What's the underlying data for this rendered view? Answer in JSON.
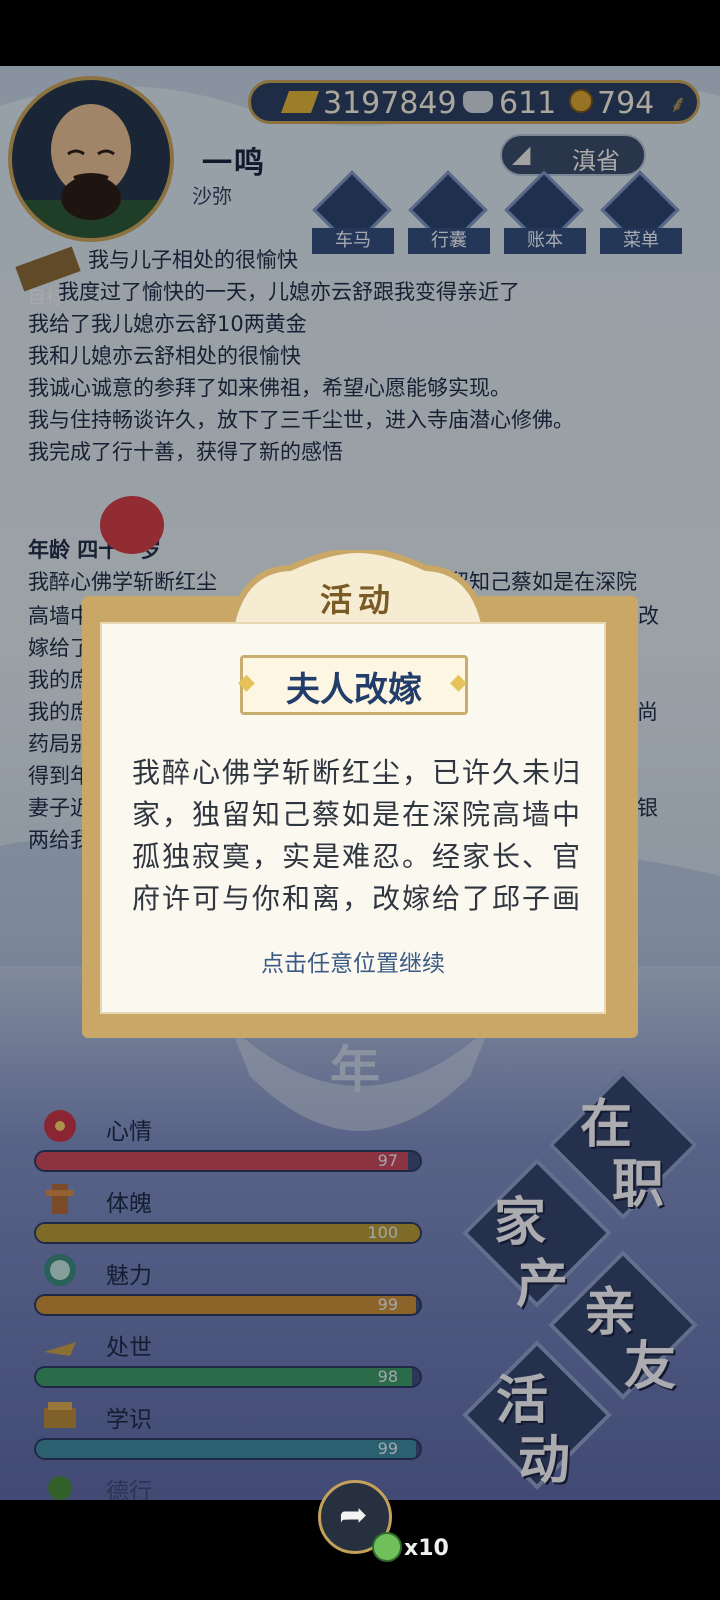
{
  "resources": {
    "gold": "3197849",
    "silver": "611",
    "coin": "794"
  },
  "player": {
    "name": "一鸣",
    "rank": "沙弥"
  },
  "province_label": "滇省",
  "top_menu": [
    {
      "label": "车马",
      "icon": "carriage-icon"
    },
    {
      "label": "行囊",
      "icon": "bundle-icon"
    },
    {
      "label": "账本",
      "icon": "ledger-icon"
    },
    {
      "label": "菜单",
      "icon": "more-icon"
    }
  ],
  "goal_label": "目标",
  "log": {
    "lines_top": [
      "我与儿子相处的很愉快",
      "我度过了愉快的一天，儿媳亦云舒跟我变得亲近了",
      "我给了我儿媳亦云舒10两黄金",
      "我和儿媳亦云舒相处的很愉快",
      "我诚心诚意的参拜了如来佛祖，希望心愿能够实现。",
      "我与住持畅谈许久，放下了三千尘世，进入寺庙潜心修佛。",
      "我完成了行十善，获得了新的感悟"
    ],
    "age_header": "年龄 四十一岁",
    "lines_bottom_left": [
      "我醉心佛学斩断红尘",
      "高墙中",
      "嫁给了",
      "我的庶",
      "我的庶",
      "药局别",
      "得到年",
      "妻子近",
      "两给我"
    ],
    "lines_bottom_right": [
      "留知己蔡如是在深院",
      "改",
      "",
      "",
      "入尚",
      "",
      "",
      "些银",
      ""
    ]
  },
  "modal": {
    "header": "活动",
    "event_title": "夫人改嫁",
    "body": "我醉心佛学斩断红尘，已许久未归家，独留知己蔡如是在深院高墙中孤独寂寞，实是难忍。经家长、官府许可与你和离，改嫁给了邱子画",
    "continue_hint": "点击任意位置继续"
  },
  "year_char": "年",
  "stats": [
    {
      "label": "心情",
      "value": 97,
      "fraction": 0.97,
      "color": "#c9495e",
      "icon": "flower-icon"
    },
    {
      "label": "体魄",
      "value": 100,
      "fraction": 1.0,
      "color": "#b79a3a",
      "icon": "strength-icon"
    },
    {
      "label": "魅力",
      "value": 99,
      "fraction": 0.99,
      "color": "#c98f3a",
      "icon": "mirror-icon"
    },
    {
      "label": "处世",
      "value": 98,
      "fraction": 0.98,
      "color": "#3f9a6a",
      "icon": "fan-icon"
    },
    {
      "label": "学识",
      "value": 99,
      "fraction": 0.99,
      "color": "#3d8aa0",
      "icon": "books-icon"
    },
    {
      "label": "德行",
      "value": "",
      "fraction": 0.9,
      "color": "#6a3b7a",
      "icon": "virtue-icon"
    }
  ],
  "big_buttons": [
    {
      "key": "employment",
      "chars": [
        "在",
        "职"
      ]
    },
    {
      "key": "property",
      "chars": [
        "家",
        "产"
      ]
    },
    {
      "key": "friends",
      "chars": [
        "亲",
        "友"
      ]
    },
    {
      "key": "activity",
      "chars": [
        "活",
        "动"
      ]
    }
  ],
  "share": {
    "count": "x10"
  },
  "colors": {
    "gold_frame": "#c9a767",
    "navy": "#2c3f63",
    "modal_bg": "#fbf8ef"
  }
}
